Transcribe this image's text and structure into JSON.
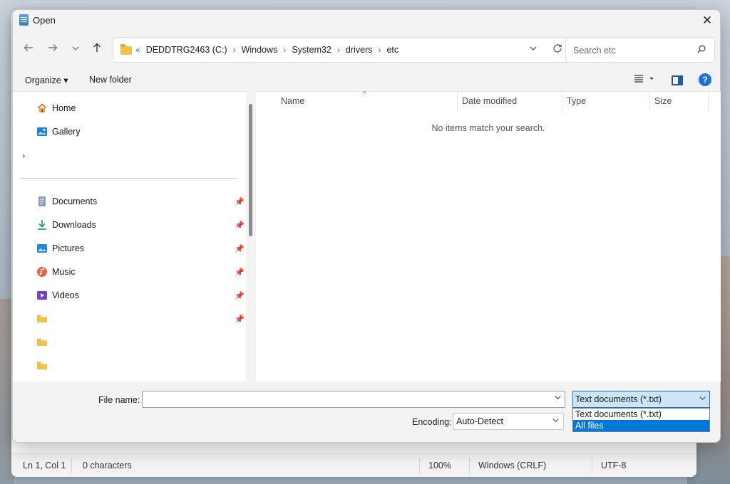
{
  "dialog": {
    "title": "Open",
    "close_glyph": "✕"
  },
  "address": {
    "overflow_glyph": "«",
    "crumbs": [
      "DEDDTRG2463 (C:)",
      "Windows",
      "System32",
      "drivers",
      "etc"
    ]
  },
  "search": {
    "placeholder": "Search etc"
  },
  "toolbar": {
    "organize_label": "Organize ▾",
    "new_folder_label": "New folder"
  },
  "sidebar": {
    "items": [
      {
        "label": "Home",
        "icon": "home-icon"
      },
      {
        "label": "Gallery",
        "icon": "gallery-icon"
      }
    ],
    "pinned": [
      {
        "label": "Documents",
        "icon": "documents-icon"
      },
      {
        "label": "Downloads",
        "icon": "downloads-icon"
      },
      {
        "label": "Pictures",
        "icon": "pictures-icon"
      },
      {
        "label": "Music",
        "icon": "music-icon"
      },
      {
        "label": "Videos",
        "icon": "videos-icon"
      },
      {
        "label": "",
        "icon": "folder-icon"
      },
      {
        "label": "",
        "icon": "folder-icon"
      },
      {
        "label": "",
        "icon": "folder-icon"
      }
    ]
  },
  "columns": {
    "name": "Name",
    "date_modified": "Date modified",
    "type": "Type",
    "size": "Size"
  },
  "content": {
    "empty_message": "No items match your search."
  },
  "file_name": {
    "label": "File name:",
    "value": ""
  },
  "file_type": {
    "selected": "Text documents (*.txt)",
    "options": [
      "Text documents (*.txt)",
      "All files"
    ],
    "highlighted_index": 1
  },
  "encoding": {
    "label": "Encoding:",
    "value": "Auto-Detect"
  },
  "statusbar": {
    "position": "Ln 1, Col 1",
    "characters": "0 characters",
    "zoom": "100%",
    "line_endings": "Windows (CRLF)",
    "encoding": "UTF-8"
  },
  "colors": {
    "accent": "#0078d7",
    "help": "#1a73d9",
    "folder": "#f3c04a"
  }
}
